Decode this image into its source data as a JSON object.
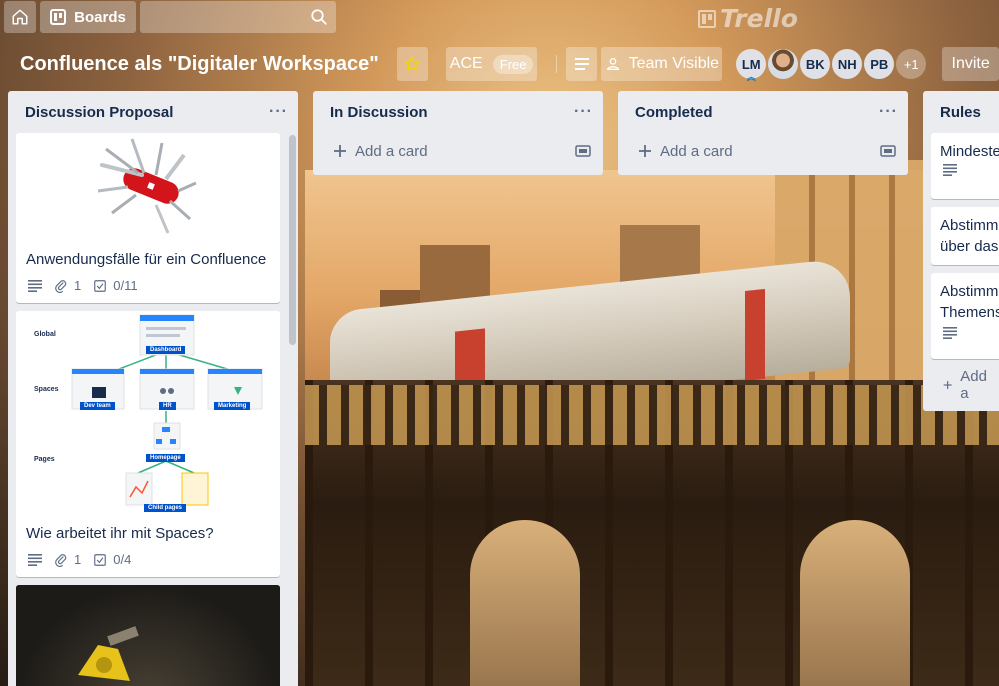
{
  "topbar": {
    "boards_label": "Boards",
    "logo_text": "Trello"
  },
  "board": {
    "title": "Confluence als \"Digitaler Workspace\"",
    "team_name": "ACE",
    "team_badge": "Free",
    "visibility": "Team Visible",
    "invite_label": "Invite",
    "members": [
      "LM",
      "",
      "BK",
      "NH",
      "PB"
    ],
    "members_more": "+1",
    "star_color": "#f2d600"
  },
  "lists": [
    {
      "title": "Discussion Proposal",
      "cards": [
        {
          "title": "Anwendungsfälle für ein Confluence",
          "attachments": "1",
          "checklist": "0/11",
          "cover": "swiss-army-knife-image"
        },
        {
          "title": "Wie arbeitet ihr mit Spaces?",
          "attachments": "1",
          "checklist": "0/4",
          "cover": "confluence-spaces-diagram",
          "diagram": {
            "row_labels": [
              "Global",
              "Spaces",
              "Pages"
            ],
            "nodes": [
              "Dashboard",
              "Dev team",
              "HR",
              "Marketing",
              "Homepage",
              "Child pages"
            ]
          }
        },
        {
          "title": "",
          "cover": "yellow-tool-image"
        }
      ]
    },
    {
      "title": "In Discussion",
      "add_label": "Add a card"
    },
    {
      "title": "Completed",
      "add_label": "Add a card"
    },
    {
      "title": "Rules",
      "cards": [
        {
          "title": "Mindeste"
        },
        {
          "title": "Abstimm\nüber das"
        },
        {
          "title": "Abstimm\nThemens"
        }
      ],
      "add_label": "Add a"
    }
  ],
  "colors": {
    "list_bg": "#ebecf0",
    "text": "#172b4d",
    "muted": "#5e6c84",
    "diagram_blue": "#0052cc",
    "diagram_green": "#36b37e"
  }
}
